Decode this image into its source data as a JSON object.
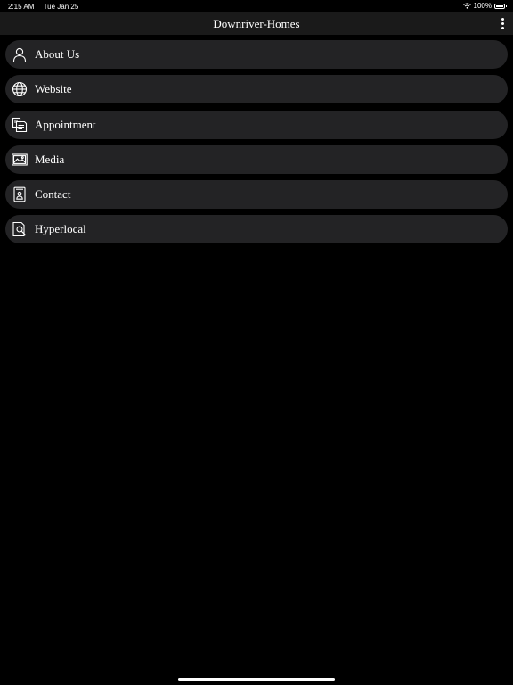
{
  "status_bar": {
    "time": "2:15 AM",
    "date": "Tue Jan 25",
    "battery": "100%",
    "battery_level": 1.0
  },
  "header": {
    "title": "Downriver-Homes",
    "more_icon": "vertical-ellipsis-icon"
  },
  "menu": {
    "items": [
      {
        "label": "About Us",
        "icon": "person-icon"
      },
      {
        "label": "Website",
        "icon": "globe-icon"
      },
      {
        "label": "Appointment",
        "icon": "documents-icon"
      },
      {
        "label": "Media",
        "icon": "image-icon"
      },
      {
        "label": "Contact",
        "icon": "contact-card-icon"
      },
      {
        "label": "Hyperlocal",
        "icon": "document-search-icon"
      }
    ]
  },
  "colors": {
    "background": "#000000",
    "nav_bar": "#1a1a1a",
    "menu_item": "#232325",
    "text": "#ffffff"
  }
}
